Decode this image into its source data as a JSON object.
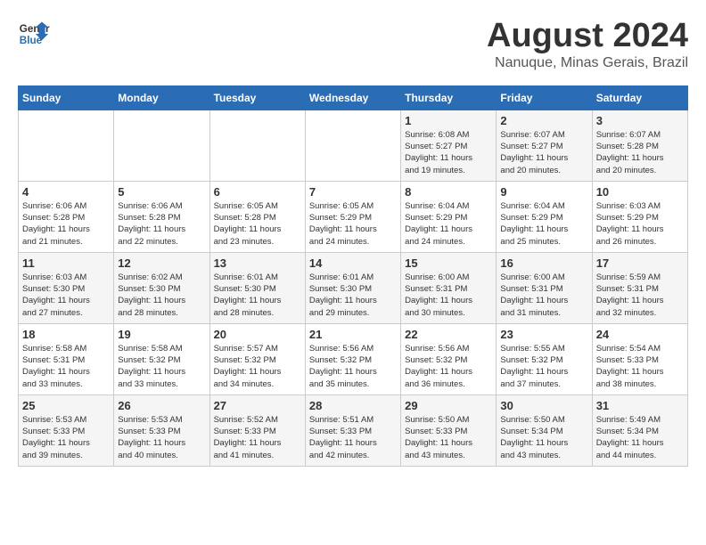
{
  "header": {
    "logo_line1": "General",
    "logo_line2": "Blue",
    "title": "August 2024",
    "subtitle": "Nanuque, Minas Gerais, Brazil"
  },
  "days_of_week": [
    "Sunday",
    "Monday",
    "Tuesday",
    "Wednesday",
    "Thursday",
    "Friday",
    "Saturday"
  ],
  "weeks": [
    [
      {
        "day": "",
        "info": ""
      },
      {
        "day": "",
        "info": ""
      },
      {
        "day": "",
        "info": ""
      },
      {
        "day": "",
        "info": ""
      },
      {
        "day": "1",
        "info": "Sunrise: 6:08 AM\nSunset: 5:27 PM\nDaylight: 11 hours\nand 19 minutes."
      },
      {
        "day": "2",
        "info": "Sunrise: 6:07 AM\nSunset: 5:27 PM\nDaylight: 11 hours\nand 20 minutes."
      },
      {
        "day": "3",
        "info": "Sunrise: 6:07 AM\nSunset: 5:28 PM\nDaylight: 11 hours\nand 20 minutes."
      }
    ],
    [
      {
        "day": "4",
        "info": "Sunrise: 6:06 AM\nSunset: 5:28 PM\nDaylight: 11 hours\nand 21 minutes."
      },
      {
        "day": "5",
        "info": "Sunrise: 6:06 AM\nSunset: 5:28 PM\nDaylight: 11 hours\nand 22 minutes."
      },
      {
        "day": "6",
        "info": "Sunrise: 6:05 AM\nSunset: 5:28 PM\nDaylight: 11 hours\nand 23 minutes."
      },
      {
        "day": "7",
        "info": "Sunrise: 6:05 AM\nSunset: 5:29 PM\nDaylight: 11 hours\nand 24 minutes."
      },
      {
        "day": "8",
        "info": "Sunrise: 6:04 AM\nSunset: 5:29 PM\nDaylight: 11 hours\nand 24 minutes."
      },
      {
        "day": "9",
        "info": "Sunrise: 6:04 AM\nSunset: 5:29 PM\nDaylight: 11 hours\nand 25 minutes."
      },
      {
        "day": "10",
        "info": "Sunrise: 6:03 AM\nSunset: 5:29 PM\nDaylight: 11 hours\nand 26 minutes."
      }
    ],
    [
      {
        "day": "11",
        "info": "Sunrise: 6:03 AM\nSunset: 5:30 PM\nDaylight: 11 hours\nand 27 minutes."
      },
      {
        "day": "12",
        "info": "Sunrise: 6:02 AM\nSunset: 5:30 PM\nDaylight: 11 hours\nand 28 minutes."
      },
      {
        "day": "13",
        "info": "Sunrise: 6:01 AM\nSunset: 5:30 PM\nDaylight: 11 hours\nand 28 minutes."
      },
      {
        "day": "14",
        "info": "Sunrise: 6:01 AM\nSunset: 5:30 PM\nDaylight: 11 hours\nand 29 minutes."
      },
      {
        "day": "15",
        "info": "Sunrise: 6:00 AM\nSunset: 5:31 PM\nDaylight: 11 hours\nand 30 minutes."
      },
      {
        "day": "16",
        "info": "Sunrise: 6:00 AM\nSunset: 5:31 PM\nDaylight: 11 hours\nand 31 minutes."
      },
      {
        "day": "17",
        "info": "Sunrise: 5:59 AM\nSunset: 5:31 PM\nDaylight: 11 hours\nand 32 minutes."
      }
    ],
    [
      {
        "day": "18",
        "info": "Sunrise: 5:58 AM\nSunset: 5:31 PM\nDaylight: 11 hours\nand 33 minutes."
      },
      {
        "day": "19",
        "info": "Sunrise: 5:58 AM\nSunset: 5:32 PM\nDaylight: 11 hours\nand 33 minutes."
      },
      {
        "day": "20",
        "info": "Sunrise: 5:57 AM\nSunset: 5:32 PM\nDaylight: 11 hours\nand 34 minutes."
      },
      {
        "day": "21",
        "info": "Sunrise: 5:56 AM\nSunset: 5:32 PM\nDaylight: 11 hours\nand 35 minutes."
      },
      {
        "day": "22",
        "info": "Sunrise: 5:56 AM\nSunset: 5:32 PM\nDaylight: 11 hours\nand 36 minutes."
      },
      {
        "day": "23",
        "info": "Sunrise: 5:55 AM\nSunset: 5:32 PM\nDaylight: 11 hours\nand 37 minutes."
      },
      {
        "day": "24",
        "info": "Sunrise: 5:54 AM\nSunset: 5:33 PM\nDaylight: 11 hours\nand 38 minutes."
      }
    ],
    [
      {
        "day": "25",
        "info": "Sunrise: 5:53 AM\nSunset: 5:33 PM\nDaylight: 11 hours\nand 39 minutes."
      },
      {
        "day": "26",
        "info": "Sunrise: 5:53 AM\nSunset: 5:33 PM\nDaylight: 11 hours\nand 40 minutes."
      },
      {
        "day": "27",
        "info": "Sunrise: 5:52 AM\nSunset: 5:33 PM\nDaylight: 11 hours\nand 41 minutes."
      },
      {
        "day": "28",
        "info": "Sunrise: 5:51 AM\nSunset: 5:33 PM\nDaylight: 11 hours\nand 42 minutes."
      },
      {
        "day": "29",
        "info": "Sunrise: 5:50 AM\nSunset: 5:33 PM\nDaylight: 11 hours\nand 43 minutes."
      },
      {
        "day": "30",
        "info": "Sunrise: 5:50 AM\nSunset: 5:34 PM\nDaylight: 11 hours\nand 43 minutes."
      },
      {
        "day": "31",
        "info": "Sunrise: 5:49 AM\nSunset: 5:34 PM\nDaylight: 11 hours\nand 44 minutes."
      }
    ]
  ]
}
